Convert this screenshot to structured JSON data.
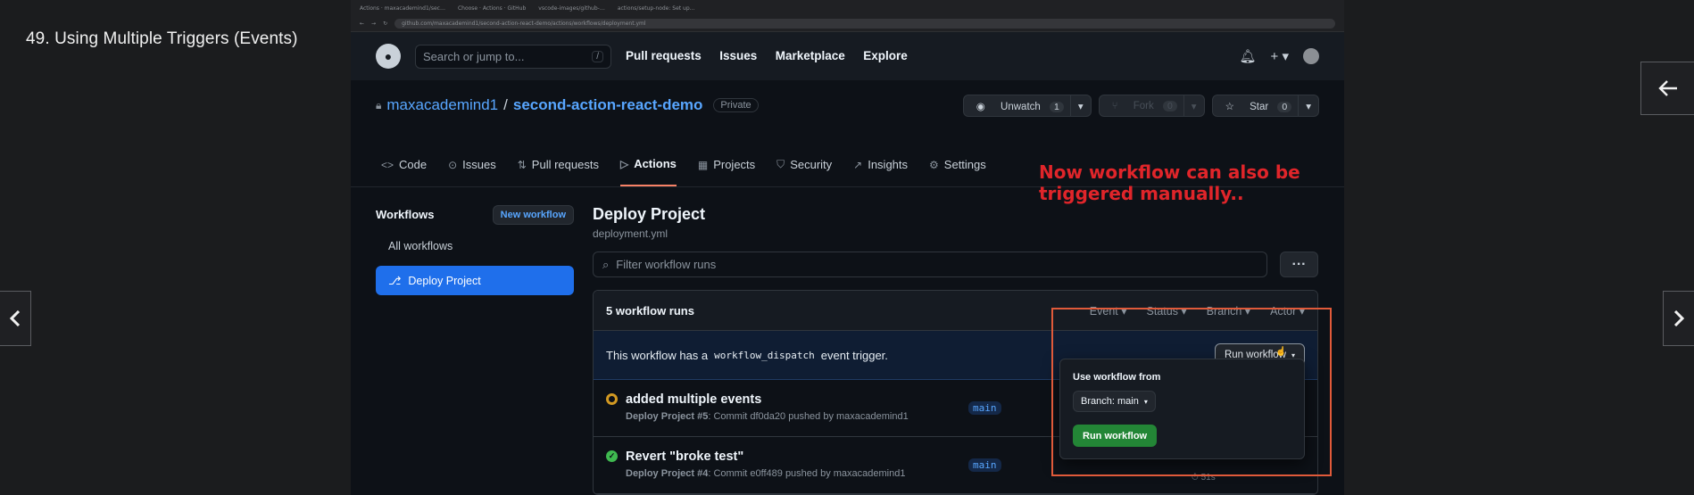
{
  "lesson": {
    "title": "49. Using Multiple Triggers (Events)"
  },
  "browser": {
    "tabs": [
      "Actions · maxacademind1/sec…",
      "Choose · Actions · GitHub",
      "vscode-images/github-…",
      "actions/setup-node: Set up…"
    ],
    "url": "github.com/maxacademind1/second-action-react-demo/actions/workflows/deployment.yml"
  },
  "header": {
    "search_placeholder": "Search or jump to...",
    "slash": "/",
    "nav": [
      "Pull requests",
      "Issues",
      "Marketplace",
      "Explore"
    ],
    "plus": "+ ▾"
  },
  "repo": {
    "owner": "maxacademind1",
    "sep": "/",
    "name": "second-action-react-demo",
    "visibility": "Private",
    "unwatch_label": "Unwatch",
    "unwatch_count": "1",
    "fork_label": "Fork",
    "fork_count": "0",
    "star_label": "Star",
    "star_count": "0",
    "tabs": [
      {
        "icon": "<>",
        "label": "Code"
      },
      {
        "icon": "⊙",
        "label": "Issues"
      },
      {
        "icon": "⇅",
        "label": "Pull requests"
      },
      {
        "icon": "▷",
        "label": "Actions"
      },
      {
        "icon": "▦",
        "label": "Projects"
      },
      {
        "icon": "⛉",
        "label": "Security"
      },
      {
        "icon": "↗",
        "label": "Insights"
      },
      {
        "icon": "⚙",
        "label": "Settings"
      }
    ]
  },
  "sidebar": {
    "title": "Workflows",
    "new_workflow": "New workflow",
    "items": [
      "All workflows",
      "Deploy Project"
    ]
  },
  "main": {
    "title": "Deploy Project",
    "subtitle": "deployment.yml",
    "filter_placeholder": "Filter workflow runs",
    "more": "···",
    "runs_count": "5 workflow runs",
    "filters": [
      "Event ▾",
      "Status ▾",
      "Branch ▾",
      "Actor ▾"
    ],
    "dispatch_prefix": "This workflow has a",
    "dispatch_code": "workflow_dispatch",
    "dispatch_suffix": "event trigger.",
    "run_workflow": "Run workflow",
    "runs": [
      {
        "status": "pending",
        "title": "added multiple events",
        "workflow": "Deploy Project #5",
        "meta": ": Commit df0da20 pushed by maxacademind1",
        "branch": "main",
        "duration": ""
      },
      {
        "status": "success",
        "title": "Revert \"broke test\"",
        "workflow": "Deploy Project #4",
        "meta": ": Commit e0ff489 pushed by maxacademind1",
        "branch": "main",
        "duration": "⏱ 51s"
      }
    ]
  },
  "popup": {
    "label": "Use workflow from",
    "branch_button": "Branch: main",
    "run_button": "Run workflow"
  },
  "annotation": {
    "line1": "Now workflow can also be",
    "line2": "triggered manually.."
  },
  "colors": {
    "annotation": "#e0252a",
    "highlight": "#e05a3a",
    "accent": "#1f6feb",
    "tab_underline": "#f78166"
  }
}
